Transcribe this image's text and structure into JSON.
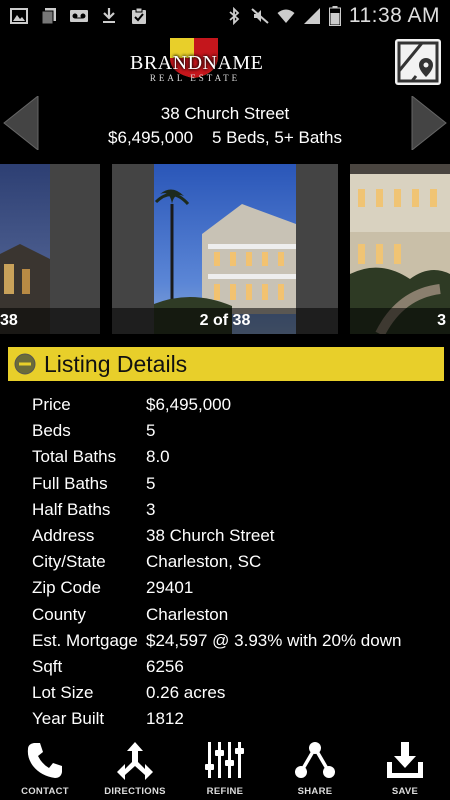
{
  "status_bar": {
    "time": "11:38 AM"
  },
  "header": {
    "brand_name": "BRANDNAME",
    "brand_sub": "REAL ESTATE",
    "address": "38 Church Street",
    "summary": "$6,495,000    5 Beds, 5+ Baths"
  },
  "gallery": {
    "prev_caption": "38",
    "current_caption": "2 of 38",
    "next_caption": "3"
  },
  "section": {
    "title": "Listing Details"
  },
  "details": [
    {
      "label": "Price",
      "value": "$6,495,000"
    },
    {
      "label": "Beds",
      "value": "5"
    },
    {
      "label": "Total Baths",
      "value": "8.0"
    },
    {
      "label": "Full Baths",
      "value": "5"
    },
    {
      "label": "Half Baths",
      "value": "3"
    },
    {
      "label": "Address",
      "value": "38 Church Street"
    },
    {
      "label": "City/State",
      "value": "Charleston, SC"
    },
    {
      "label": "Zip Code",
      "value": "29401"
    },
    {
      "label": "County",
      "value": "Charleston"
    },
    {
      "label": "Est. Mortgage",
      "value": "$24,597 @ 3.93% with 20% down"
    },
    {
      "label": "Sqft",
      "value": "6256"
    },
    {
      "label": "Lot Size",
      "value": "0.26 acres"
    },
    {
      "label": "Year Built",
      "value": "1812"
    }
  ],
  "nav": [
    {
      "label": "CONTACT",
      "icon": "phone-icon"
    },
    {
      "label": "DIRECTIONS",
      "icon": "directions-icon"
    },
    {
      "label": "REFINE",
      "icon": "sliders-icon"
    },
    {
      "label": "SHARE",
      "icon": "share-icon"
    },
    {
      "label": "SAVE",
      "icon": "download-icon"
    }
  ],
  "colors": {
    "accent": "#e8cf2a",
    "background": "#000000"
  }
}
